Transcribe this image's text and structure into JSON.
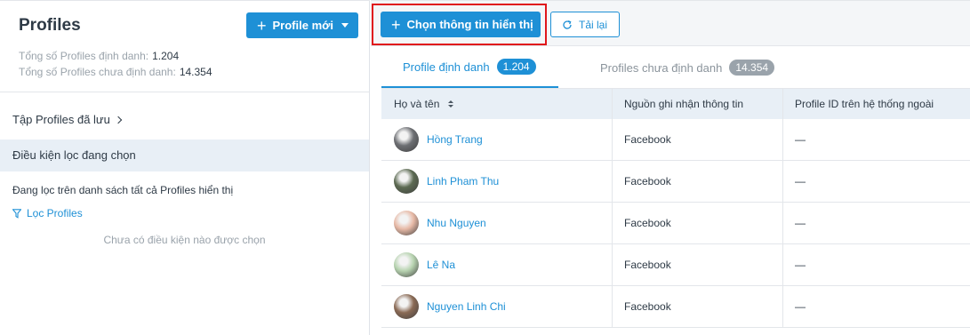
{
  "left": {
    "title": "Profiles",
    "new_button": "Profile mới",
    "stats": [
      {
        "label": "Tổng số Profiles định danh:",
        "value": "1.204"
      },
      {
        "label": "Tổng số Profiles chưa định danh:",
        "value": "14.354"
      }
    ],
    "saved_sets": "Tập Profiles đã lưu",
    "conditions_header": "Điều kiện lọc đang chọn",
    "filtering_text": "Đang lọc trên danh sách tất cả Profiles hiển thị",
    "filter_link": "Lọc Profiles",
    "empty_text": "Chưa có điều kiện nào được chọn"
  },
  "toolbar": {
    "select_info_button": "Chọn thông tin hiển thị",
    "reload_button": "Tải lại",
    "highlight_color": "#e0161b",
    "accent_color": "#1e90d6"
  },
  "tabs": [
    {
      "label": "Profile định danh",
      "count": "1.204"
    },
    {
      "label": "Profiles chưa định danh",
      "count": "14.354"
    }
  ],
  "table": {
    "headers": [
      "Họ và tên",
      "Nguồn ghi nhận thông tin",
      "Profile ID trên hệ thống ngoài"
    ],
    "rows": [
      {
        "name": "Hồng Trang",
        "source": "Facebook",
        "external_id": "—",
        "avatar_color": "#6d6f73"
      },
      {
        "name": "Linh Pham Thu",
        "source": "Facebook",
        "external_id": "—",
        "avatar_color": "#5c6a52"
      },
      {
        "name": "Nhu Nguyen",
        "source": "Facebook",
        "external_id": "—",
        "avatar_color": "#e7b9a6"
      },
      {
        "name": "Lê Na",
        "source": "Facebook",
        "external_id": "—",
        "avatar_color": "#b7d3b0"
      },
      {
        "name": "Nguyen Linh Chi",
        "source": "Facebook",
        "external_id": "—",
        "avatar_color": "#8a6a55"
      }
    ]
  }
}
